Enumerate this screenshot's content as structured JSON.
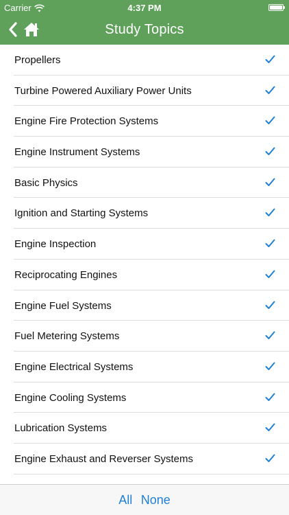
{
  "status_bar": {
    "carrier": "Carrier",
    "time": "4:37 PM",
    "wifi_icon": "wifi-icon",
    "battery_icon": "battery-icon",
    "battery_level": 1.0
  },
  "nav": {
    "title": "Study Topics",
    "back_icon": "chevron-left-icon",
    "home_icon": "home-icon",
    "background_color": "#5fa05a"
  },
  "topics": [
    {
      "label": "Propellers",
      "checked": true
    },
    {
      "label": "Turbine Powered Auxiliary Power Units",
      "checked": true
    },
    {
      "label": "Engine Fire Protection Systems",
      "checked": true
    },
    {
      "label": "Engine Instrument Systems",
      "checked": true
    },
    {
      "label": "Basic Physics",
      "checked": true
    },
    {
      "label": "Ignition and Starting Systems",
      "checked": true
    },
    {
      "label": "Engine Inspection",
      "checked": true
    },
    {
      "label": "Reciprocating Engines",
      "checked": true
    },
    {
      "label": "Engine Fuel Systems",
      "checked": true
    },
    {
      "label": "Fuel Metering Systems",
      "checked": true
    },
    {
      "label": "Engine Electrical Systems",
      "checked": true
    },
    {
      "label": "Engine Cooling Systems",
      "checked": true
    },
    {
      "label": "Lubrication Systems",
      "checked": true
    },
    {
      "label": "Engine Exhaust and Reverser Systems",
      "checked": true
    }
  ],
  "check_color": "#1f7fd4",
  "toolbar": {
    "all_label": "All",
    "none_label": "None"
  }
}
